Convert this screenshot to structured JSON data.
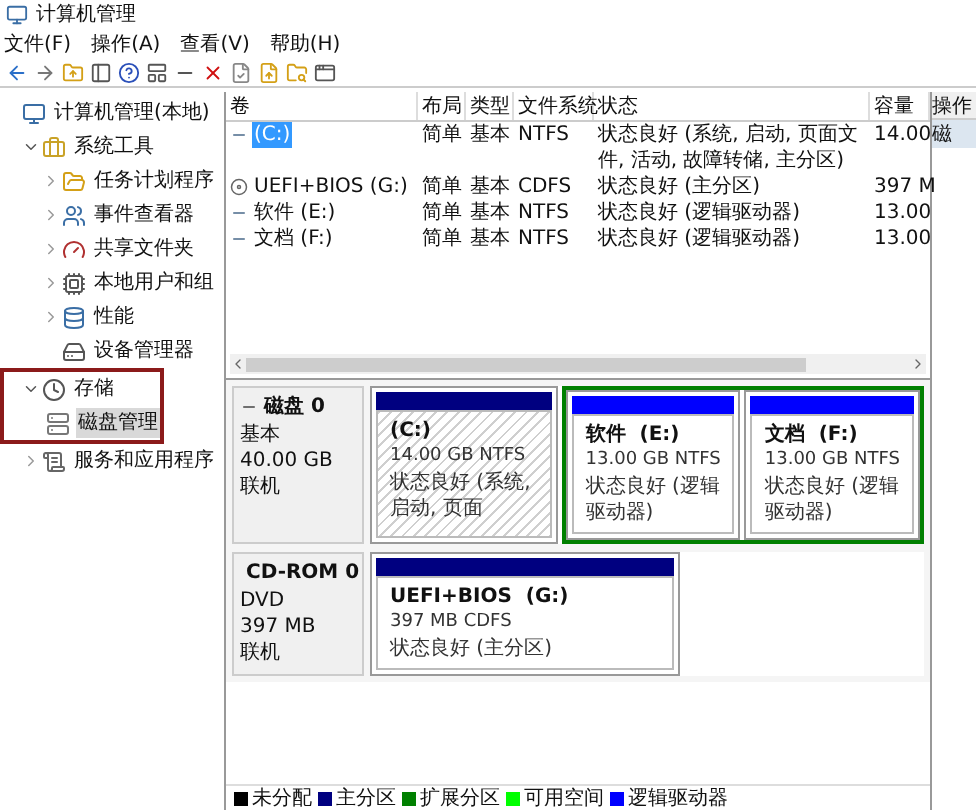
{
  "window": {
    "title": "计算机管理"
  },
  "menu": [
    "文件(F)",
    "操作(A)",
    "查看(V)",
    "帮助(H)"
  ],
  "tree": [
    {
      "label": "计算机管理(本地)",
      "selected": false,
      "children": [
        {
          "label": "系统工具",
          "expanded": true,
          "selected": false,
          "children": [
            {
              "label": "任务计划程序",
              "expanded": false,
              "selected": false
            },
            {
              "label": "事件查看器",
              "expanded": false,
              "selected": false
            },
            {
              "label": "共享文件夹",
              "expanded": false,
              "selected": false
            },
            {
              "label": "本地用户和组",
              "expanded": false,
              "selected": false
            },
            {
              "label": "性能",
              "expanded": false,
              "selected": false
            },
            {
              "label": "设备管理器",
              "selected": false
            }
          ]
        },
        {
          "label": "存储",
          "expanded": true,
          "selected": false,
          "annotated": true,
          "children": [
            {
              "label": "磁盘管理",
              "selected": true
            }
          ]
        },
        {
          "label": "服务和应用程序",
          "expanded": false,
          "selected": false
        }
      ]
    }
  ],
  "table": {
    "columns": [
      "卷",
      "布局",
      "类型",
      "文件系统",
      "状态",
      "容量"
    ],
    "rows": [
      {
        "kind": "disk",
        "selected": true,
        "cells": [
          "(C:)",
          "简单",
          "基本",
          "NTFS",
          "状态良好 (系统, 启动, 页面文件, 活动, 故障转储, 主分区)",
          "14.00"
        ]
      },
      {
        "kind": "cdrom",
        "selected": false,
        "cells": [
          "UEFI+BIOS (G:)",
          "简单",
          "基本",
          "CDFS",
          "状态良好 (主分区)",
          "397 M"
        ]
      },
      {
        "kind": "disk",
        "selected": false,
        "cells": [
          "软件 (E:)",
          "简单",
          "基本",
          "NTFS",
          "状态良好 (逻辑驱动器)",
          "13.00"
        ]
      },
      {
        "kind": "disk",
        "selected": false,
        "cells": [
          "文档 (F:)",
          "简单",
          "基本",
          "NTFS",
          "状态良好 (逻辑驱动器)",
          "13.00"
        ]
      }
    ]
  },
  "disks": [
    {
      "kind": "basic",
      "name": "磁盘 0",
      "type": "基本",
      "size": "40.00 GB",
      "status": "联机",
      "partitions": [
        {
          "kind": "primary",
          "selected": true,
          "name": "(C:)",
          "size": "14.00 GB NTFS",
          "status": "状态良好 (系统, 启动, 页面"
        },
        {
          "kind": "extended",
          "children": [
            {
              "kind": "logical",
              "selected": false,
              "name": "软件  (E:)",
              "size": "13.00 GB NTFS",
              "status": "状态良好 (逻辑驱动器)"
            },
            {
              "kind": "logical",
              "selected": false,
              "name": "文档  (F:)",
              "size": "13.00 GB NTFS",
              "status": "状态良好 (逻辑驱动器)"
            }
          ]
        }
      ]
    },
    {
      "kind": "cdrom",
      "name": "CD-ROM 0",
      "type": "DVD",
      "size": "397 MB",
      "status": "联机",
      "partitions": [
        {
          "kind": "primary",
          "selected": false,
          "name": "UEFI+BIOS  (G:)",
          "size": "397 MB CDFS",
          "status": "状态良好 (主分区)"
        }
      ]
    }
  ],
  "legend": [
    {
      "label": "未分配",
      "color": "#000000"
    },
    {
      "label": "主分区",
      "color": "#000080"
    },
    {
      "label": "扩展分区",
      "color": "#008000"
    },
    {
      "label": "可用空间",
      "color": "#00ff00"
    },
    {
      "label": "逻辑驱动器",
      "color": "#0000ff"
    }
  ],
  "actions": {
    "title": "操作",
    "items": [
      {
        "label": "磁",
        "selected": true
      }
    ]
  }
}
